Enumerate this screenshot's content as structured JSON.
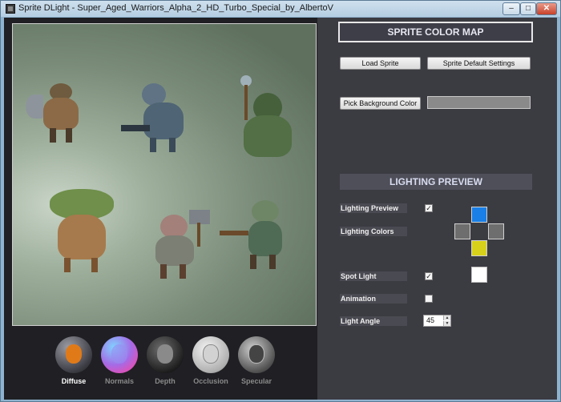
{
  "window": {
    "title": "Sprite DLight - Super_Aged_Warriors_Alpha_2_HD_Turbo_Special_by_AlbertoV",
    "controls": {
      "minimize": "–",
      "maximize": "□",
      "close": "✕"
    }
  },
  "render_modes": [
    {
      "label": "Diffuse",
      "active": true
    },
    {
      "label": "Normals",
      "active": false
    },
    {
      "label": "Depth",
      "active": false
    },
    {
      "label": "Occlusion",
      "active": false
    },
    {
      "label": "Specular",
      "active": false
    }
  ],
  "color_map": {
    "header": "SPRITE COLOR MAP",
    "load_sprite": "Load Sprite",
    "default_settings": "Sprite Default Settings",
    "pick_background": "Pick Background Color",
    "background_color": "#8a8a8a"
  },
  "lighting": {
    "header": "LIGHTING PREVIEW",
    "lighting_preview_label": "Lighting Preview",
    "lighting_preview_checked": "✓",
    "lighting_colors_label": "Lighting Colors",
    "colors": {
      "top": "#1a7fe6",
      "left": "#6e6e6e",
      "right": "#6e6e6e",
      "bottom": "#d8d11b"
    },
    "spot_light_label": "Spot Light",
    "spot_light_checked": "✓",
    "spot_light_color": "#ffffff",
    "animation_label": "Animation",
    "animation_checked": "",
    "light_angle_label": "Light Angle",
    "light_angle_value": "45"
  }
}
